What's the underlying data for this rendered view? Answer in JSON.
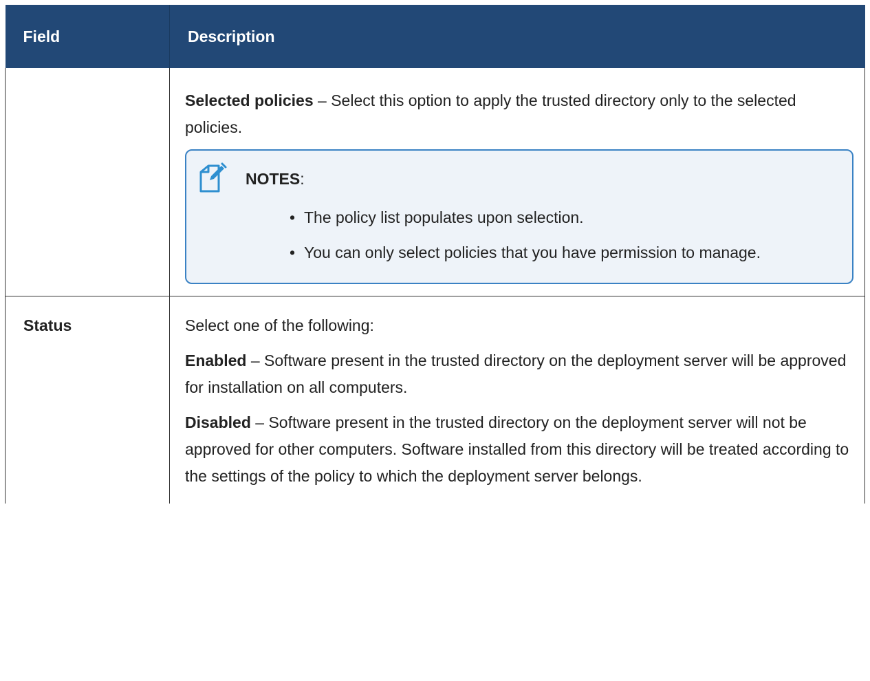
{
  "table": {
    "header": {
      "field": "Field",
      "description": "Description"
    },
    "rows": [
      {
        "field": "",
        "selected_policies": {
          "term": "Selected policies",
          "text": " – Select this option to apply the trusted directory only to the selected policies."
        },
        "note": {
          "icon": "note-pencil-icon",
          "heading": "NOTES",
          "heading_suffix": ":",
          "items": [
            "The policy list populates upon selection.",
            "You can only select policies that you have permission to manage."
          ]
        }
      },
      {
        "field": "Status",
        "intro": "Select one of the following:",
        "enabled": {
          "term": "Enabled",
          "text": " – Software present in the trusted directory on the deployment server will be approved for installation on all computers."
        },
        "disabled": {
          "term": "Disabled",
          "text": " – Software present in the trusted directory on the deployment server will not be approved for other computers. Software installed from this directory will be treated according to the settings of the policy to which the deployment server belongs."
        }
      }
    ]
  },
  "colors": {
    "header_bg": "#224876",
    "header_text": "#ffffff",
    "note_border": "#3a82c4",
    "note_bg": "#eef3f9"
  }
}
